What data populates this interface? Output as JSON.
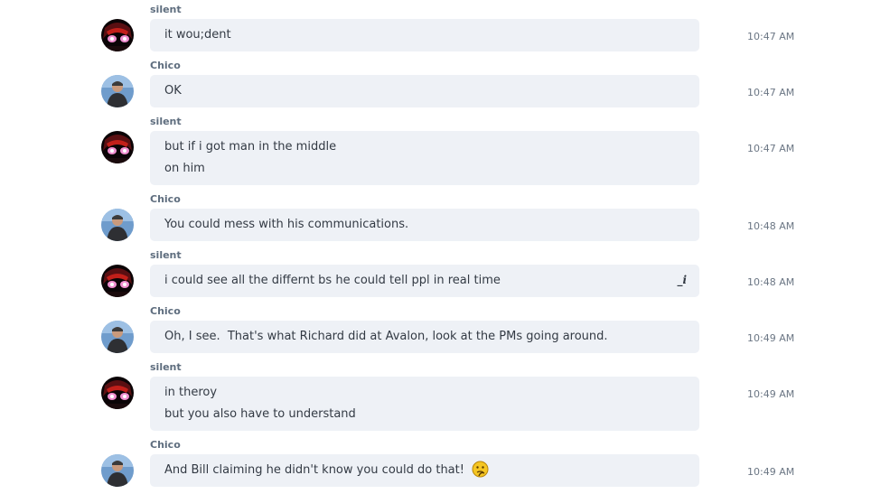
{
  "messages": [
    {
      "sender": "silent",
      "avatar": "silent-avatar-icon",
      "lines": [
        "it wou;dent"
      ],
      "time": "10:47 AM"
    },
    {
      "sender": "Chico",
      "avatar": "chico-avatar-icon",
      "lines": [
        "OK"
      ],
      "time": "10:47 AM"
    },
    {
      "sender": "silent",
      "avatar": "silent-avatar-icon",
      "lines": [
        "but if i got man in the middle",
        "on him"
      ],
      "time": "10:47 AM"
    },
    {
      "sender": "Chico",
      "avatar": "chico-avatar-icon",
      "lines": [
        "You could mess with his communications."
      ],
      "time": "10:48 AM"
    },
    {
      "sender": "silent",
      "avatar": "silent-avatar-icon",
      "lines": [
        "i could see all the differnt bs he could tell ppl in real time"
      ],
      "time": "10:48 AM",
      "edit_icon": "edit-cursor-icon",
      "edit_text": "_i"
    },
    {
      "sender": "Chico",
      "avatar": "chico-avatar-icon",
      "lines": [
        "Oh, I see.  That's what Richard did at Avalon, look at the PMs going around."
      ],
      "time": "10:49 AM"
    },
    {
      "sender": "silent",
      "avatar": "silent-avatar-icon",
      "lines": [
        "in theroy",
        "but you also have to understand"
      ],
      "time": "10:49 AM"
    },
    {
      "sender": "Chico",
      "avatar": "chico-avatar-icon",
      "lines": [
        "And Bill claiming he didn't know you could do that!"
      ],
      "time": "10:49 AM",
      "emoji": "thinking-emoji-icon"
    }
  ],
  "colors": {
    "bubble": "#eef1f6",
    "sender": "#5e6d7e",
    "text": "#333a44",
    "time": "#6b7684",
    "background": "#ffffff"
  }
}
